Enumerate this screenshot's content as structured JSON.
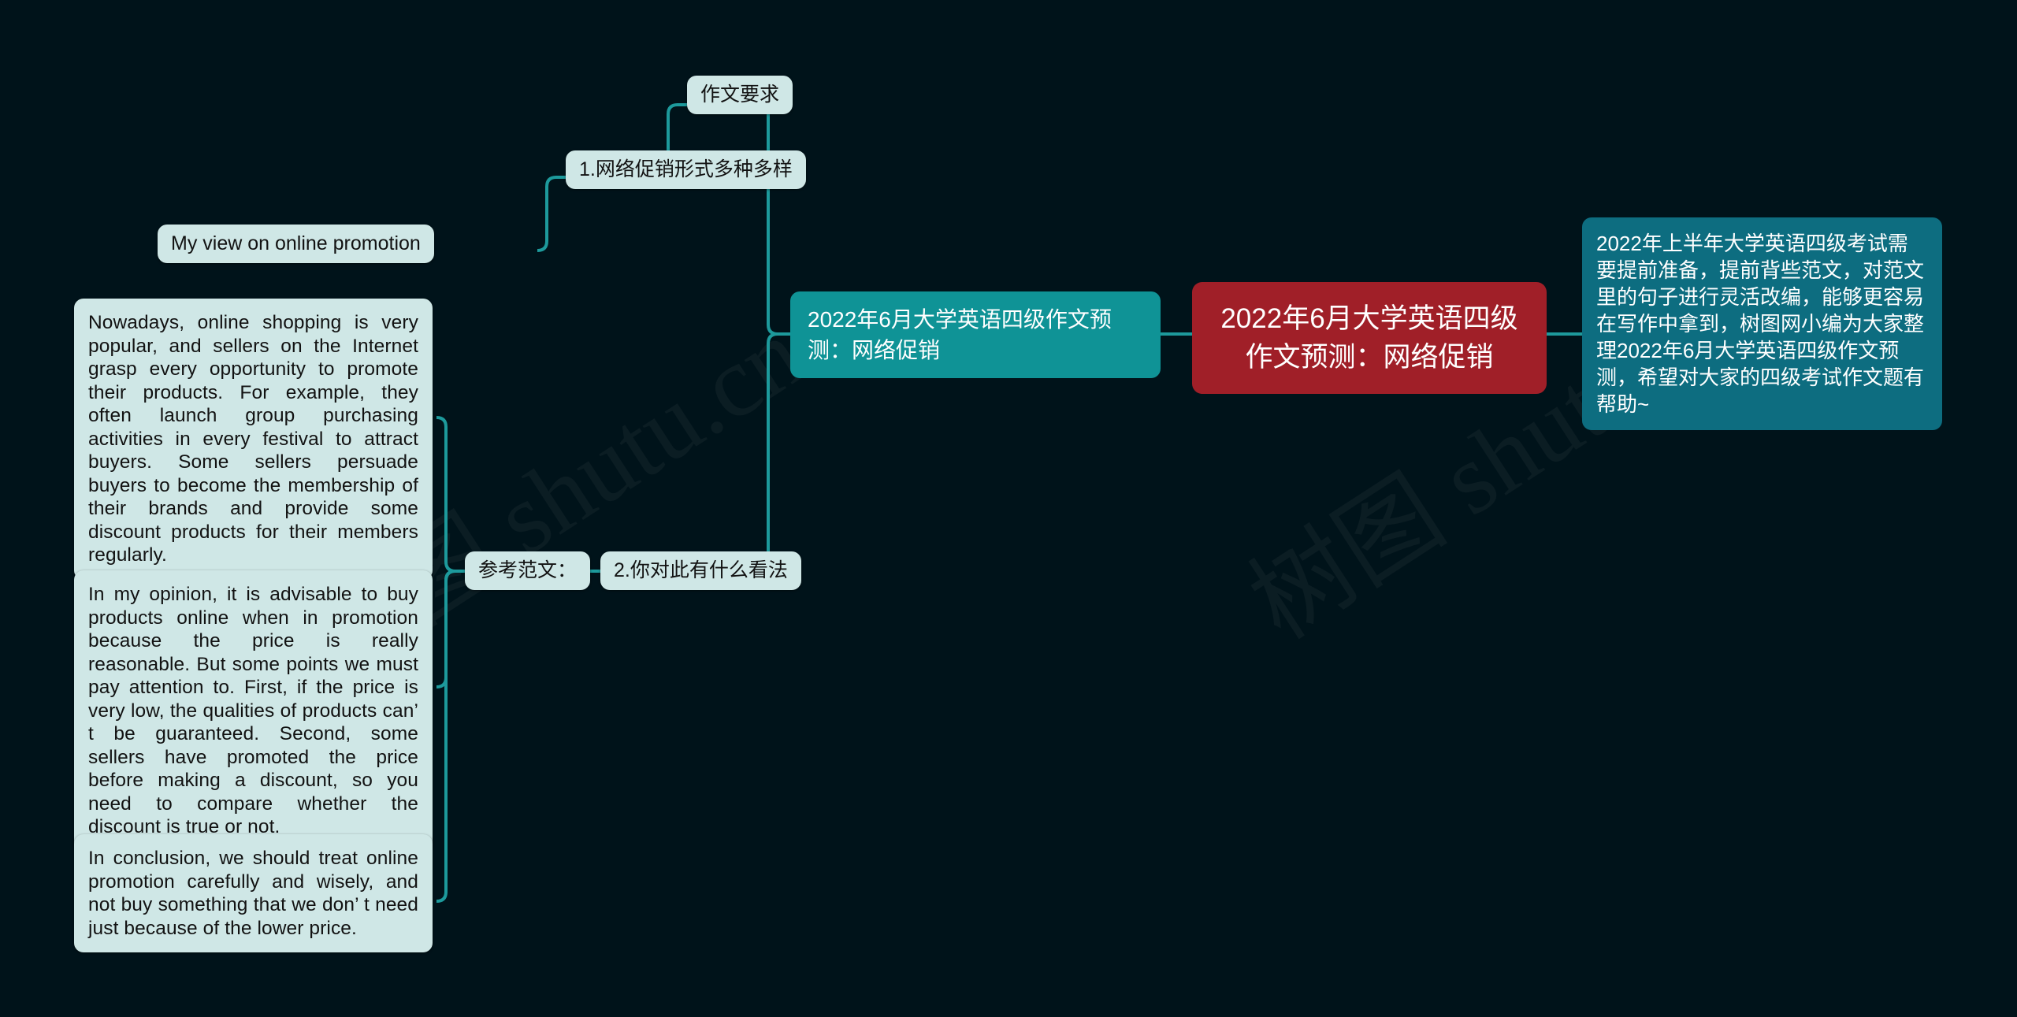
{
  "meta": {
    "background_color": "#00131a",
    "accent_teal": "#1d9a9c",
    "node_light_bg": "#cfe7e6",
    "node_teal_bg": "#0f9396",
    "node_teal_dark_bg": "#0d6d80",
    "node_red_bg": "#a01f28"
  },
  "watermark": {
    "text": "树图 shutu.cn"
  },
  "center_node": {
    "title": "2022年6月大学英语四级作文预测：网络促销"
  },
  "right_node": {
    "text": "2022年上半年大学英语四级考试需要提前准备，提前背些范文，对范文里的句子进行灵活改编，能够更容易在写作中拿到，树图网小编为大家整理2022年6月大学英语四级作文预测，希望对大家的四级考试作文题有帮助~"
  },
  "subtitle_node": {
    "text": "2022年6月大学英语四级作文预测：网络促销"
  },
  "branches": {
    "requirement": {
      "label": "作文要求",
      "points": [
        {
          "label": "1.网络促销形式多种多样"
        },
        {
          "label": "2.你对此有什么看法"
        }
      ],
      "topic": {
        "label": "My view on online promotion"
      }
    },
    "sample": {
      "label": "参考范文：",
      "paragraphs": [
        {
          "text": "Nowadays, online shopping is very popular, and sellers on the Internet grasp every opportunity to promote their products. For example, they often launch group purchasing activities in every festival to attract buyers. Some sellers persuade buyers to become the membership of their brands and provide some discount products for their members regularly."
        },
        {
          "text": "In my opinion, it is advisable to buy products online when in promotion because the price is really reasonable. But some points we must pay attention to. First, if the price is very low, the qualities of products can’ t be guaranteed. Second, some sellers have promoted the price before making a discount, so you need to compare whether the discount is true or not."
        },
        {
          "text": "In conclusion, we should treat online promotion carefully and wisely, and not buy something that we don’ t need just because of the lower price."
        }
      ]
    }
  }
}
